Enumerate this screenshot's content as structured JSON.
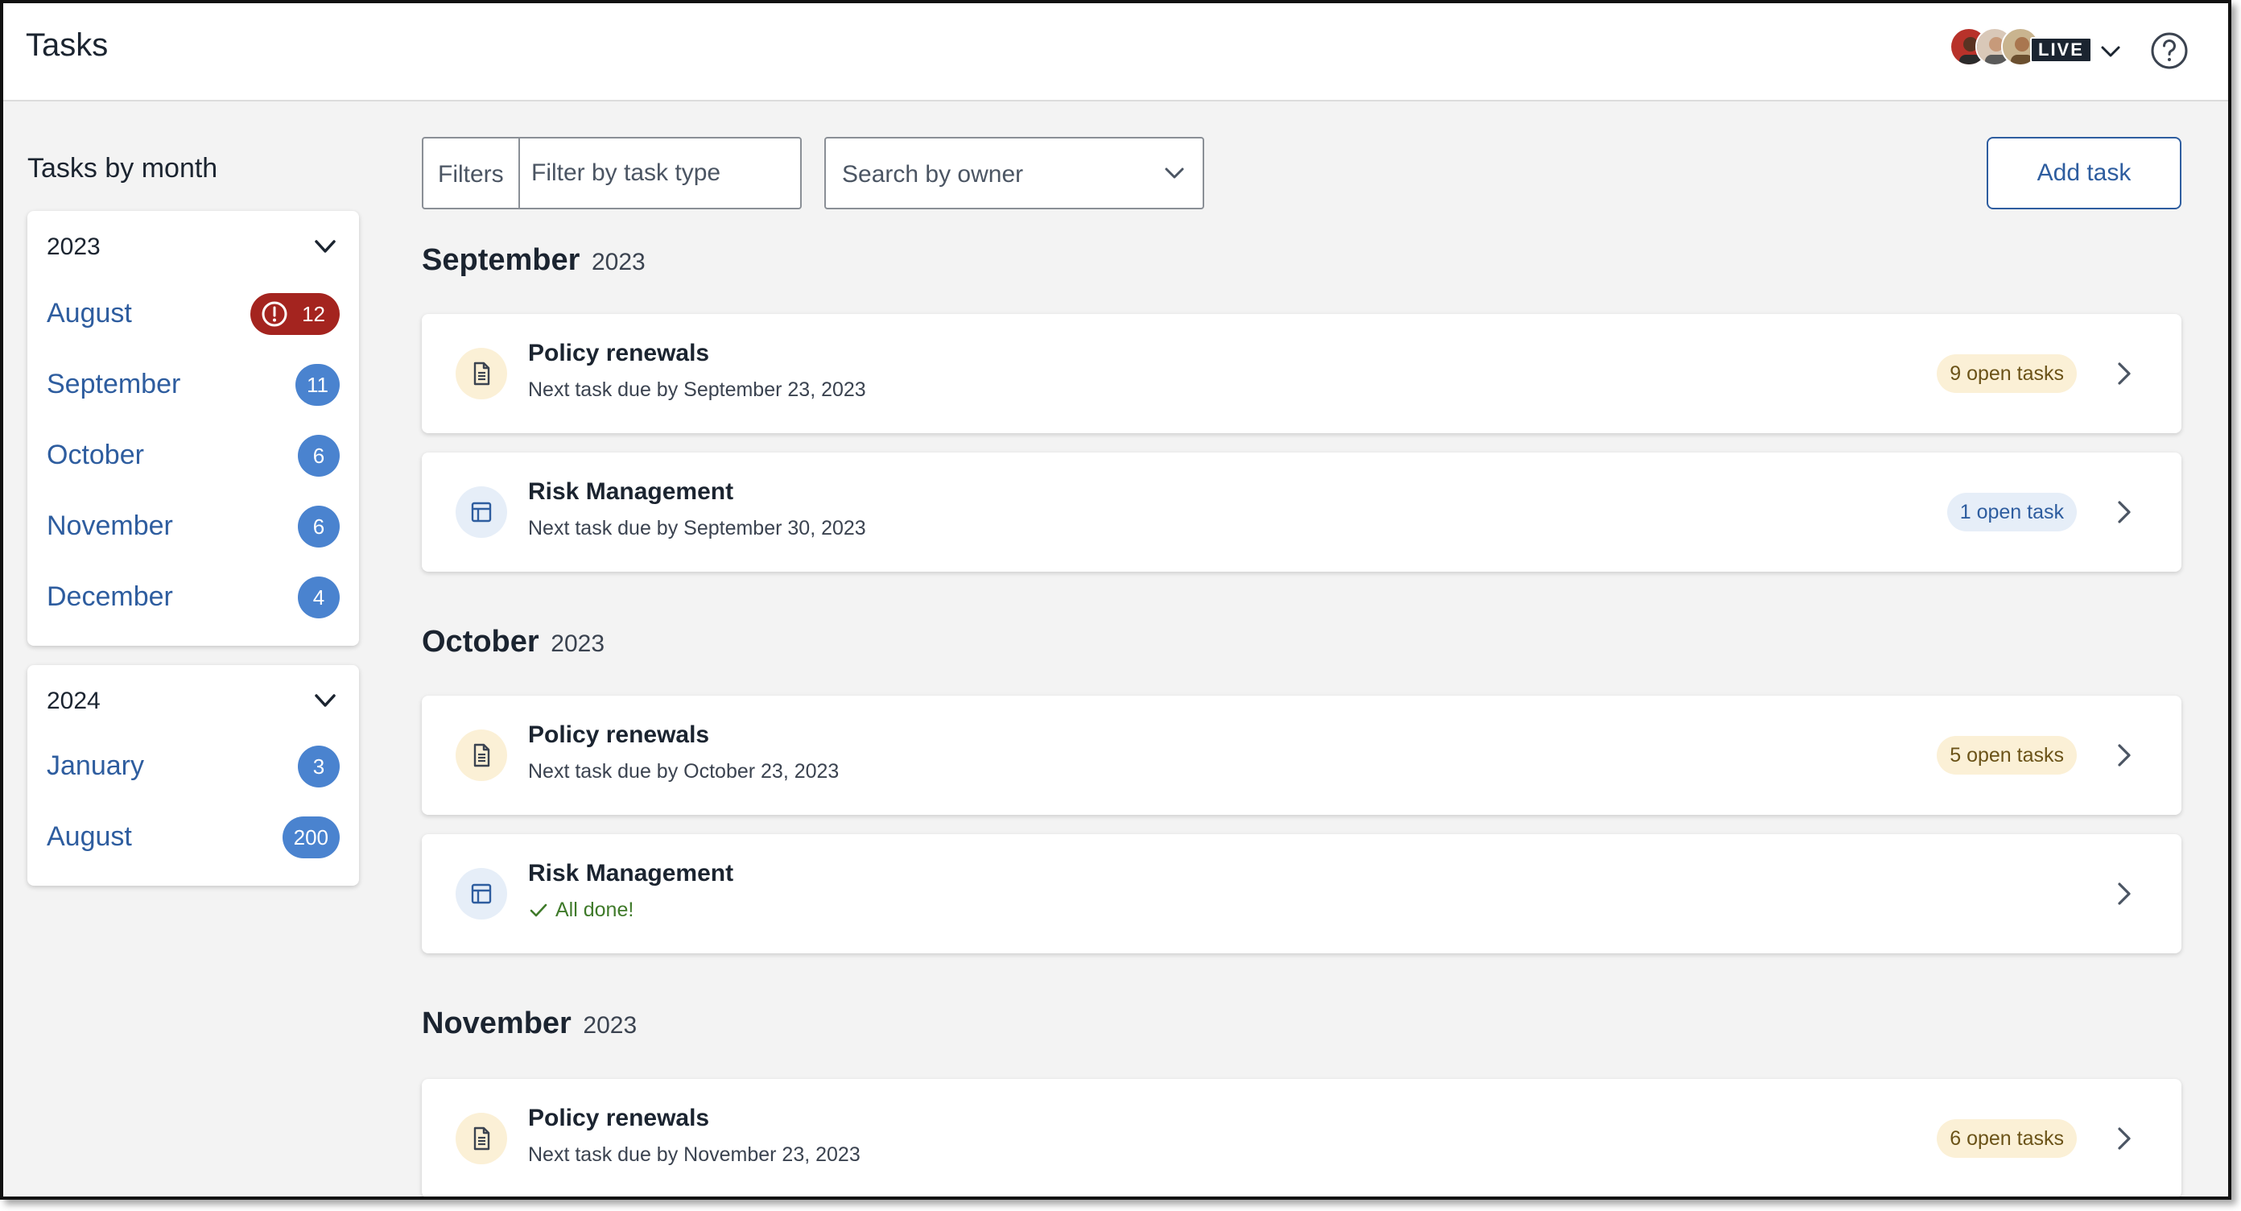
{
  "header": {
    "title": "Tasks",
    "live_label": "LIVE"
  },
  "sidebar": {
    "heading": "Tasks by month",
    "years": [
      {
        "year": "2023",
        "months": [
          {
            "label": "August",
            "count": "12",
            "alert": true
          },
          {
            "label": "September",
            "count": "11",
            "alert": false
          },
          {
            "label": "October",
            "count": "6",
            "alert": false
          },
          {
            "label": "November",
            "count": "6",
            "alert": false
          },
          {
            "label": "December",
            "count": "4",
            "alert": false
          }
        ]
      },
      {
        "year": "2024",
        "months": [
          {
            "label": "January",
            "count": "3",
            "alert": false
          },
          {
            "label": "August",
            "count": "200",
            "alert": false
          }
        ]
      }
    ]
  },
  "toolbar": {
    "filters_label": "Filters",
    "filter_placeholder": "Filter by task type",
    "owner_placeholder": "Search by owner",
    "add_task_label": "Add task"
  },
  "sections": [
    {
      "month": "September",
      "year": "2023",
      "tasks": [
        {
          "icon": "document-icon",
          "title": "Policy renewals",
          "subtitle": "Next task due by September 23, 2023",
          "badge": "9 open tasks",
          "badge_style": "warm"
        },
        {
          "icon": "table-icon",
          "title": "Risk Management",
          "subtitle": "Next task due by September 30, 2023",
          "badge": "1 open task",
          "badge_style": "cool"
        }
      ]
    },
    {
      "month": "October",
      "year": "2023",
      "tasks": [
        {
          "icon": "document-icon",
          "title": "Policy renewals",
          "subtitle": "Next task due by October 23, 2023",
          "badge": "5 open tasks",
          "badge_style": "warm"
        },
        {
          "icon": "table-icon",
          "title": "Risk Management",
          "subtitle": "All done!",
          "badge": "",
          "badge_style": "none"
        }
      ]
    },
    {
      "month": "November",
      "year": "2023",
      "tasks": [
        {
          "icon": "document-icon",
          "title": "Policy renewals",
          "subtitle": "Next task due by November 23, 2023",
          "badge": "6 open tasks",
          "badge_style": "warm"
        }
      ]
    }
  ],
  "colors": {
    "link_blue": "#2e5d9f",
    "badge_blue": "#4a83cf",
    "alert_red": "#a4241f",
    "warm_pill": "#fbf0d6",
    "cool_pill": "#e6eef8",
    "done_green": "#3f7a2a"
  }
}
